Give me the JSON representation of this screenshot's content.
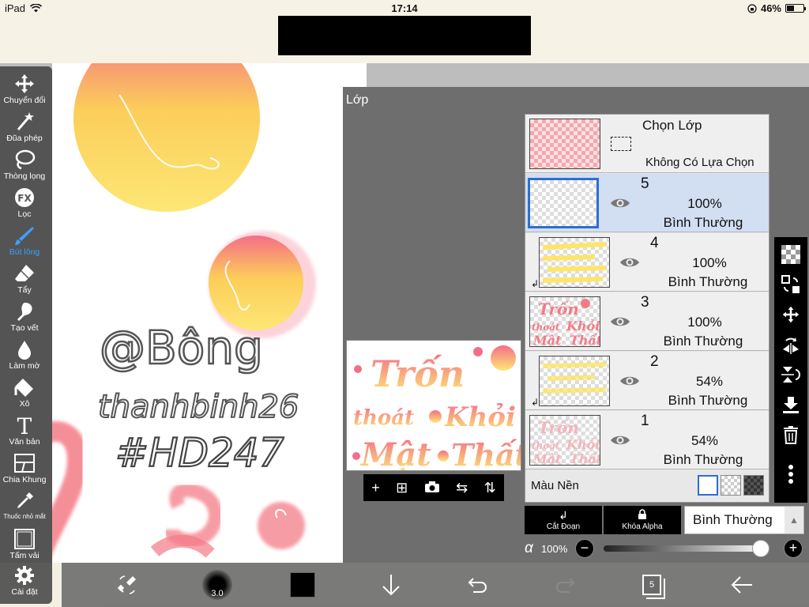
{
  "status": {
    "device": "iPad",
    "time": "17:14",
    "battery": "46%",
    "battery_level": 0.46
  },
  "toolbar": {
    "tools": [
      {
        "label": "Chuyển đổi",
        "icon": "move-arrows-icon"
      },
      {
        "label": "Đũa phép",
        "icon": "magic-wand-icon"
      },
      {
        "label": "Thòng lọng",
        "icon": "lasso-icon"
      },
      {
        "label": "Lọc",
        "icon": "fx-filter-icon"
      },
      {
        "label": "Bút lông",
        "icon": "brush-icon",
        "active": true
      },
      {
        "label": "Tẩy",
        "icon": "eraser-icon"
      },
      {
        "label": "Tạo vết",
        "icon": "smudge-icon"
      },
      {
        "label": "Làm mờ",
        "icon": "blur-drop-icon"
      },
      {
        "label": "Xô",
        "icon": "bucket-icon"
      },
      {
        "label": "Văn bản",
        "icon": "text-icon"
      },
      {
        "label": "Chia Khung",
        "icon": "frame-divider-icon"
      },
      {
        "label": "Thuốc nhỏ mắt",
        "icon": "eyedropper-icon"
      },
      {
        "label": "Tấm vải",
        "icon": "canvas-icon"
      },
      {
        "label": "Cài đặt",
        "icon": "gear-icon"
      }
    ]
  },
  "canvas": {
    "handwriting": [
      "@Bông",
      "thanhbinh26",
      "#HD247"
    ]
  },
  "layer_panel": {
    "title": "Lớp",
    "selection_layer": {
      "title": "Chọn Lớp",
      "subtitle": "Không Có Lựa Chọn"
    },
    "layers": [
      {
        "number": "5",
        "opacity": "100%",
        "blend": "Bình Thường",
        "selected": true,
        "clipped": false
      },
      {
        "number": "4",
        "opacity": "100%",
        "blend": "Bình Thường",
        "selected": false,
        "clipped": true
      },
      {
        "number": "3",
        "opacity": "100%",
        "blend": "Bình Thường",
        "selected": false,
        "clipped": false
      },
      {
        "number": "2",
        "opacity": "54%",
        "blend": "Bình Thường",
        "selected": false,
        "clipped": true
      },
      {
        "number": "1",
        "opacity": "54%",
        "blend": "Bình Thường",
        "selected": false,
        "clipped": false
      }
    ],
    "background": {
      "label": "Màu Nền"
    },
    "clip_button": "Cắt Đoạn",
    "alpha_lock_button": "Khóa Alpha",
    "blend_mode": "Bình Thường",
    "alpha": {
      "symbol": "α",
      "value": "100%",
      "level": 1.0
    },
    "preview_text": [
      "Trốn",
      "thoát",
      "Khỏi",
      "Mật",
      "Thất"
    ]
  },
  "bottombar": {
    "brush_size": "3.0",
    "color": "#000000",
    "layer_count": "5"
  },
  "colors": {
    "pink": "#f47b86",
    "yellow": "#fbe56a",
    "accent": "#2d6ed3"
  }
}
